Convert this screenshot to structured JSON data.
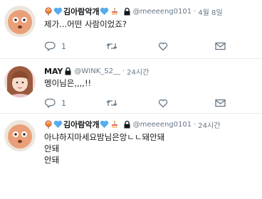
{
  "tweets": [
    {
      "display_name": "김아람악개",
      "handle": "@meeeeng0101",
      "sep": "·",
      "time": "4월 8일",
      "lines": [
        "제가...어떤 사람이었죠?"
      ],
      "reply_count": "1",
      "avatar_icon": "round-face-avatar",
      "badges": [
        "lollipop-icon",
        "blue-heart-icon"
      ]
    },
    {
      "display_name": "MAY",
      "handle": "@WINK_S2__",
      "sep": "·",
      "time": "24시간",
      "lines": [
        "멩이님은,,,,!!"
      ],
      "reply_count": "1",
      "avatar_icon": "person-photo-avatar"
    },
    {
      "display_name": "김아람악개",
      "handle": "@meeeeng0101",
      "sep": "·",
      "time": "24시간",
      "lines": [
        "아냐하지마세요밤님은앙ㄴㄴ돼안돼",
        "안돼",
        "안돼"
      ],
      "avatar_icon": "round-face-avatar",
      "badges": [
        "lollipop-icon",
        "blue-heart-icon"
      ]
    }
  ],
  "colors": {
    "text": "#14171a",
    "muted": "#657786",
    "divider": "#e6ecf0",
    "heart": "#55acee"
  }
}
